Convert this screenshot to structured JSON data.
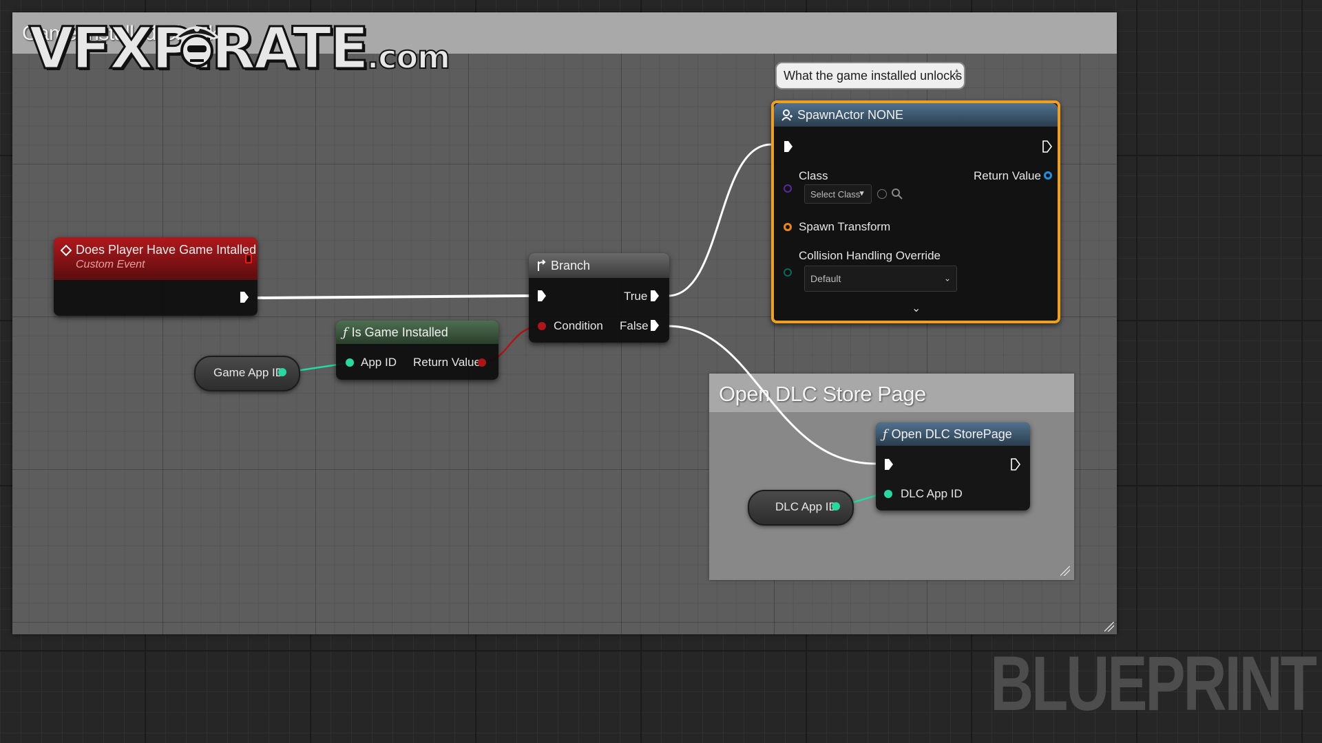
{
  "comment_main": {
    "title": "Game Installed Check"
  },
  "logo": {
    "main": "VFXPIRATE",
    "suffix": ".com"
  },
  "watermark": "BLUEPRINT",
  "event_node": {
    "title": "Does Player Have Game Intalled",
    "subtitle": "Custom Event",
    "header_color": "#8b1212"
  },
  "branch_node": {
    "title": "Branch",
    "true_label": "True",
    "false_label": "False",
    "condition_label": "Condition"
  },
  "is_installed_node": {
    "title": "Is Game Installed",
    "input_label": "App ID",
    "output_label": "Return Value",
    "header_color": "#3f5f3f"
  },
  "game_app_id_var": {
    "label": "Game App ID"
  },
  "spawn_node": {
    "title": "SpawnActor NONE",
    "class_label": "Class",
    "class_dropdown": "Select Class",
    "return_label": "Return Value",
    "spawn_transform_label": "Spawn Transform",
    "collision_label": "Collision Handling Override",
    "collision_value": "Default",
    "border_color": "#f0a020"
  },
  "bubble": {
    "text": "What the game installed unlocks"
  },
  "comment_dlc": {
    "title": "Open DLC Store Page"
  },
  "dlc_node": {
    "title": "Open DLC StorePage",
    "input_label": "DLC App ID"
  },
  "dlc_app_id_var": {
    "label": "DLC App ID"
  },
  "colors": {
    "exec": "#ffffff",
    "bool_pin": "#b01515",
    "int_pin": "#25d9a0",
    "object_pin": "#1d8fe0",
    "class_pin": "#5a2aa0",
    "struct_pin": "#e58a1a",
    "enum_pin": "#0c6b55"
  }
}
